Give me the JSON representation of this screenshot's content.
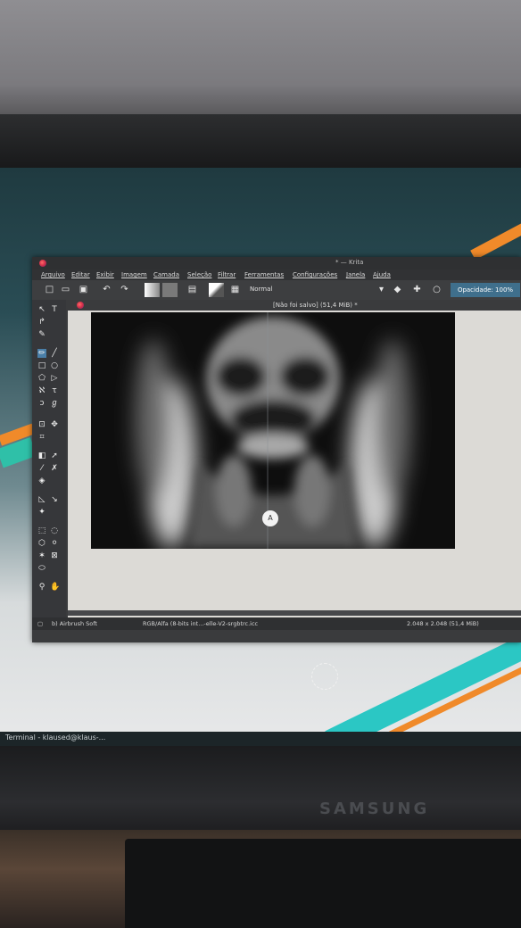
{
  "window": {
    "title": "* — Krita",
    "document_tab": "[Não foi salvo] (51,4 MiB) *"
  },
  "menu": [
    "Arquivo",
    "Editar",
    "Exibir",
    "Imagem",
    "Camada",
    "Seleção",
    "Filtrar",
    "Ferramentas",
    "Configurações",
    "Janela",
    "Ajuda"
  ],
  "toolbar": {
    "blend_mode": "Normal",
    "opacity_label": "Opacidade: 100%"
  },
  "statusbar": {
    "brush": "b) Airbrush Soft",
    "color_profile": "RGB/Alfa (8-bits int...-elle-V2-srgbtrc.icc",
    "image_size": "2.048 x 2.048 (51,4 MiB)"
  },
  "taskbar": {
    "item": "Terminal - klaused@klaus-..."
  },
  "monitor": {
    "brand": "SAMSUNG"
  },
  "canvas": {
    "assistant_handle_label": "A"
  }
}
